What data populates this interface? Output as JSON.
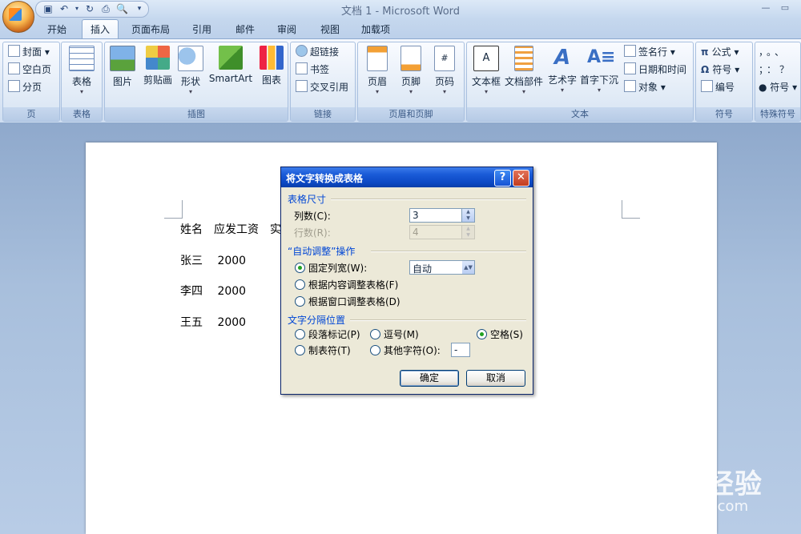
{
  "window": {
    "title": "文档 1 - Microsoft Word"
  },
  "quick_access": {
    "icons": [
      "save-icon",
      "undo-icon",
      "redo-icon",
      "print-icon",
      "print-preview-icon",
      "customize-icon"
    ]
  },
  "tabs": [
    {
      "label": "开始",
      "active": false
    },
    {
      "label": "插入",
      "active": true
    },
    {
      "label": "页面布局",
      "active": false
    },
    {
      "label": "引用",
      "active": false
    },
    {
      "label": "邮件",
      "active": false
    },
    {
      "label": "审阅",
      "active": false
    },
    {
      "label": "视图",
      "active": false
    },
    {
      "label": "加载项",
      "active": false
    }
  ],
  "ribbon": {
    "pages": {
      "label": "页",
      "items": [
        "封面",
        "空白页",
        "分页"
      ]
    },
    "tables": {
      "label": "表格",
      "button": "表格"
    },
    "illustrations": {
      "label": "插图",
      "buttons": [
        "图片",
        "剪贴画",
        "形状",
        "SmartArt",
        "图表"
      ]
    },
    "links": {
      "label": "链接",
      "items": [
        "超链接",
        "书签",
        "交叉引用"
      ]
    },
    "header_footer": {
      "label": "页眉和页脚",
      "buttons": [
        "页眉",
        "页脚",
        "页码"
      ]
    },
    "text": {
      "label": "文本",
      "buttons": [
        "文本框",
        "文档部件",
        "艺术字",
        "首字下沉"
      ],
      "items": [
        "签名行",
        "日期和时间",
        "对象"
      ]
    },
    "symbols": {
      "label": "符号",
      "items": [
        "公式",
        "符号",
        "编号"
      ]
    },
    "special": {
      "label": "特殊符号",
      "glyphs": [
        "，",
        "。",
        "、",
        "；",
        "：",
        "？"
      ],
      "item": "符号"
    }
  },
  "document": {
    "lines": [
      "姓名　应发工资　实",
      "张三　 2000",
      "李四　 2000",
      "王五　 2000"
    ]
  },
  "dialog": {
    "title": "将文字转换成表格",
    "help": "?",
    "close": "✕",
    "size_section": "表格尺寸",
    "columns_label": "列数(C):",
    "columns_value": "3",
    "rows_label": "行数(R):",
    "rows_value": "4",
    "autofit_section": "“自动调整”操作",
    "fixed_label": "固定列宽(W):",
    "fixed_value": "自动",
    "fit_content_label": "根据内容调整表格(F)",
    "fit_window_label": "根据窗口调整表格(D)",
    "separator_section": "文字分隔位置",
    "sep_paragraph": "段落标记(P)",
    "sep_comma": "逗号(M)",
    "sep_space": "空格(S)",
    "sep_tab": "制表符(T)",
    "sep_other": "其他字符(O):",
    "sep_other_value": "-",
    "ok": "确定",
    "cancel": "取消"
  },
  "watermark": {
    "main": "Baidu经验",
    "sub": "jingyan.baidu.com"
  }
}
